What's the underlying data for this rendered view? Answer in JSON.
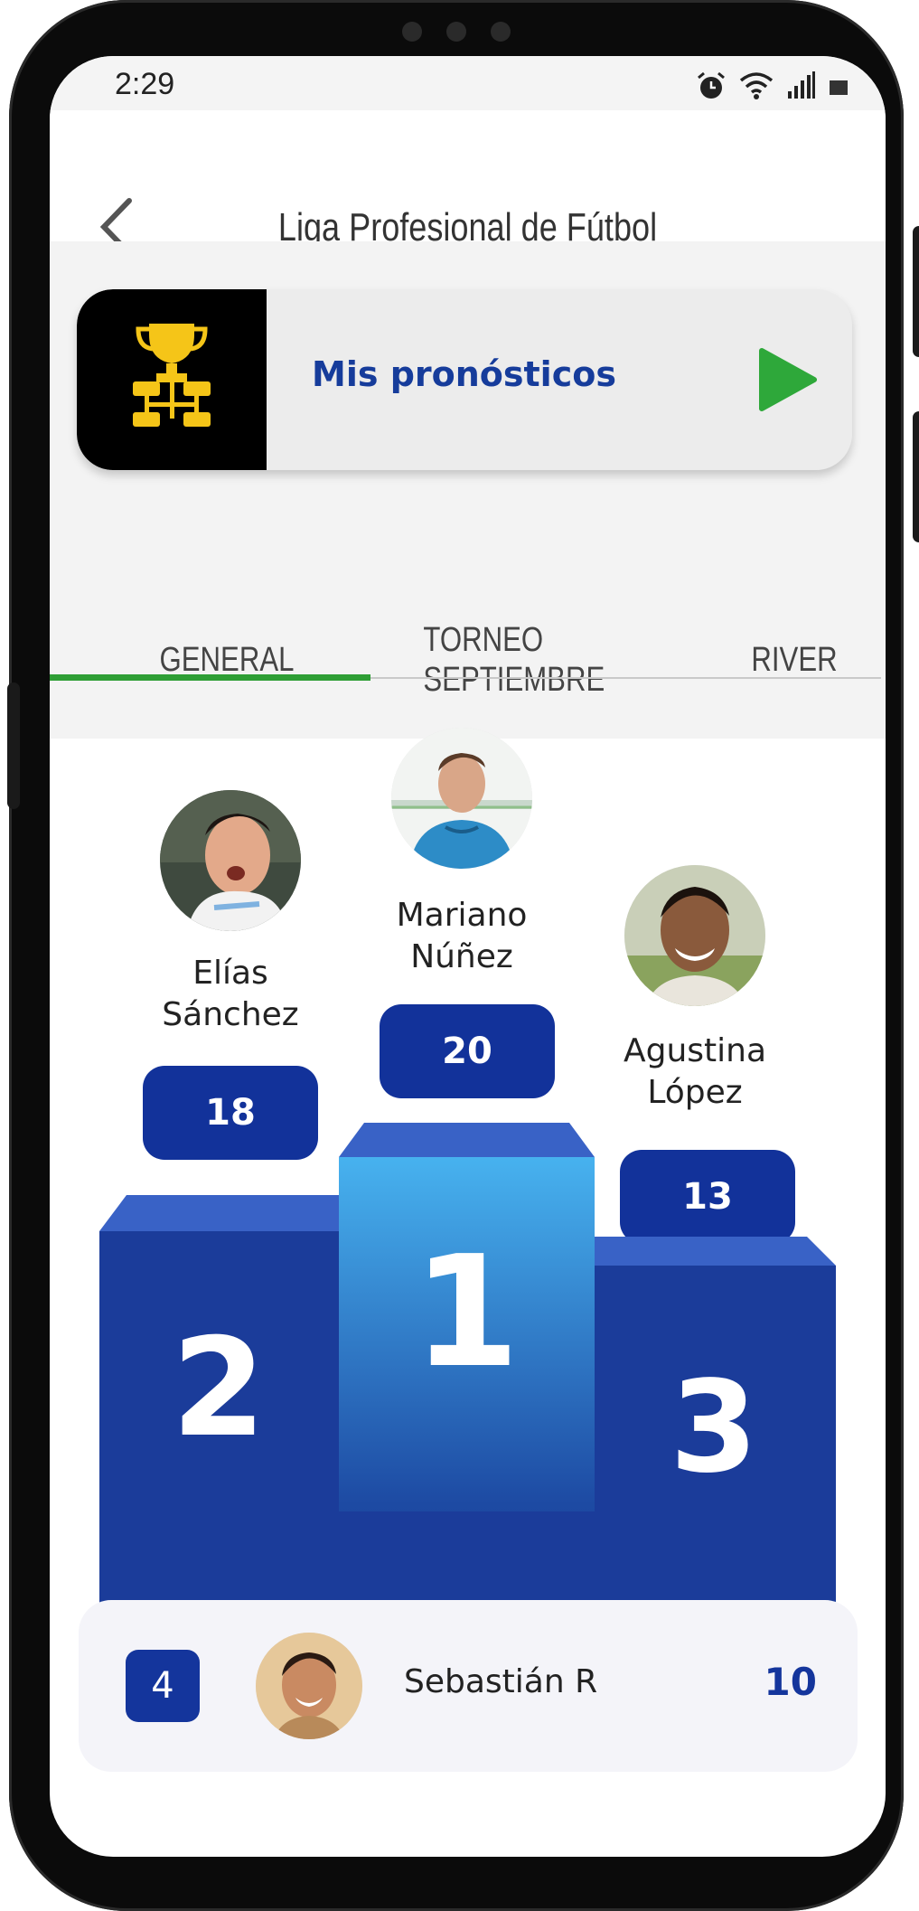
{
  "status_bar": {
    "time": "2:29",
    "icons": [
      "alarm-icon",
      "wifi-icon",
      "signal-icon",
      "battery-icon"
    ]
  },
  "header": {
    "title": "Liga Profesional de Fútbol",
    "back_icon": "chevron-left-icon"
  },
  "predictions_card": {
    "label": "Mis pronósticos",
    "icon": "trophy-bracket-icon",
    "action_icon": "play-icon",
    "colors": {
      "icon": "#f5c518",
      "play": "#2ea83a",
      "label": "#163c9b"
    }
  },
  "tabs": [
    {
      "label": "GENERAL",
      "selected": true
    },
    {
      "label": "TORNEO SEPTIEMBRE",
      "selected": false
    },
    {
      "label": "RIVER",
      "selected": false
    }
  ],
  "podium": {
    "first": {
      "name_line1": "Mariano",
      "name_line2": "Núñez",
      "points": "20",
      "place": "1"
    },
    "second": {
      "name_line1": "Elías",
      "name_line2": "Sánchez",
      "points": "18",
      "place": "2"
    },
    "third": {
      "name_line1": "Agustina",
      "name_line2": "López",
      "points": "13",
      "place": "3"
    }
  },
  "ranking_rows": [
    {
      "rank": "4",
      "name": "Sebastián R",
      "points": "10"
    }
  ],
  "colors": {
    "accent": "#2e9e35",
    "primary": "#12329a",
    "podium_blue": "#1b3c9a",
    "podium_light": "#45aeea"
  }
}
